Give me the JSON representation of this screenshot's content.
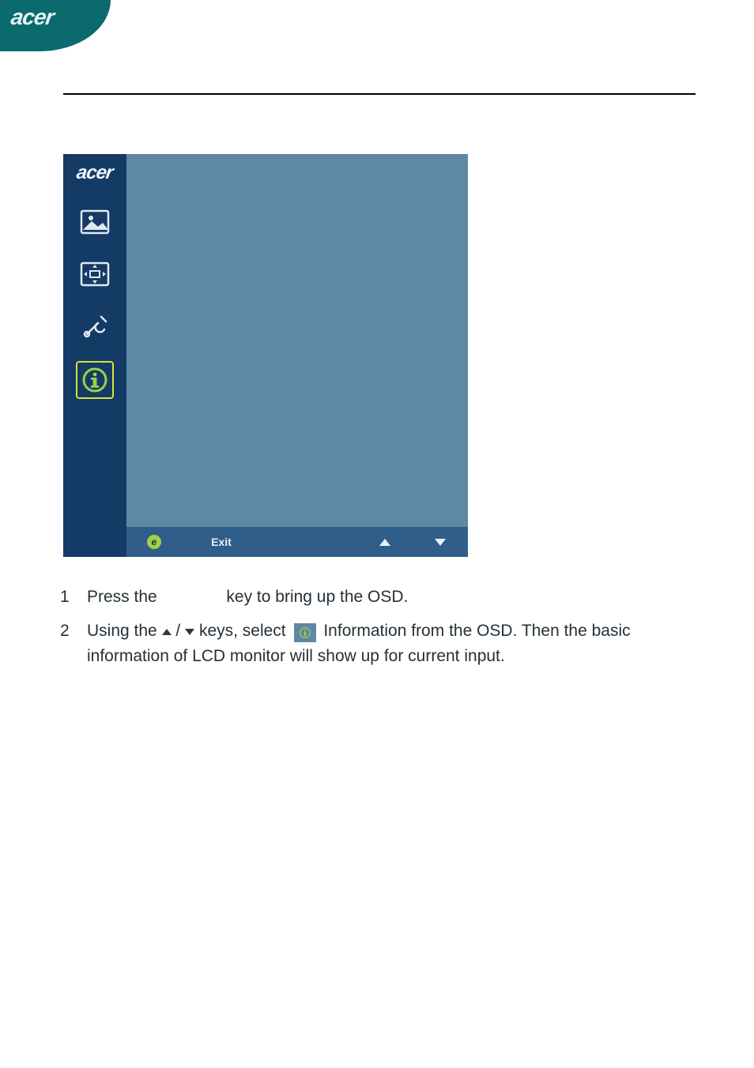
{
  "brand": "acer",
  "osd": {
    "brand": "acer",
    "sidebar_icons": [
      {
        "name": "picture-icon",
        "selected": false
      },
      {
        "name": "position-icon",
        "selected": false
      },
      {
        "name": "tools-icon",
        "selected": false
      },
      {
        "name": "info-icon",
        "selected": true
      }
    ],
    "footer": {
      "e_label": "e",
      "exit_label": "Exit"
    }
  },
  "instructions": {
    "step1_a": "Press the",
    "step1_b": "key to bring up the OSD.",
    "step2_a": "Using the",
    "step2_slash": "/",
    "step2_b": "keys, select",
    "step2_c": "Information from the OSD. Then the basic information of LCD monitor will show up for current input."
  }
}
